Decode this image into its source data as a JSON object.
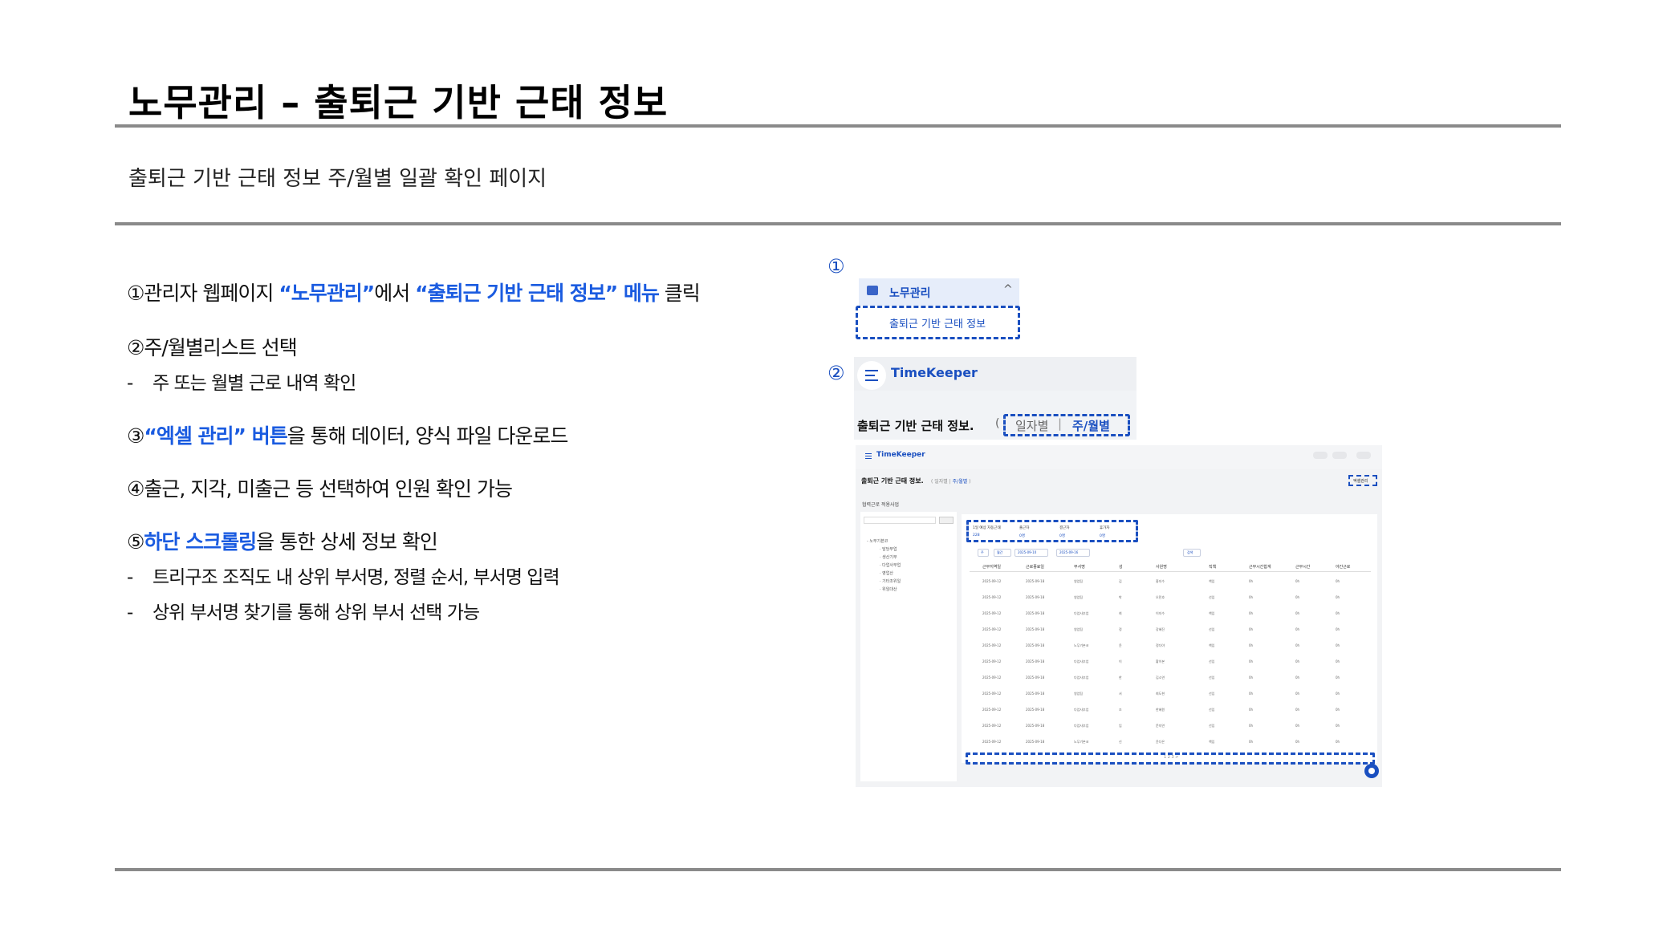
{
  "title": "노무관리 – 출퇴근 기반 근태 정보",
  "subtitle": "출퇴근 기반 근태 정보 주/월별 일괄 확인 페이지",
  "steps": [
    {
      "num": "①",
      "pre": "관리자 웹페이지 ",
      "hl1": "“노무관리”",
      "mid": "에서 ",
      "hl2": "“출퇴근 기반 근태 정보” 메뉴",
      "post": " 클릭"
    },
    {
      "num": "②",
      "text": "주/월별리스트 선택",
      "sub": "주 또는 월별 근로 내역 확인"
    },
    {
      "num": "③",
      "hl": "“엑셀 관리” 버튼",
      "post": "을 통해 데이터, 양식 파일 다운로드"
    },
    {
      "num": "④",
      "text": "출근, 지각, 미출근 등 선택하여 인원 확인 가능"
    },
    {
      "num": "⑤",
      "hl": "하단 스크롤링",
      "post": "을 통한 상세 정보 확인",
      "subs": [
        "트리구조 조직도 내 상위 부서명, 정렬 순서, 부서명 입력",
        "상위 부서명 찾기를 통해 상위 부서 선택 가능"
      ]
    }
  ],
  "dash": "-",
  "markers": [
    "①",
    "②",
    "③",
    "④",
    "⑤"
  ],
  "menu": {
    "section": "노무관리",
    "caret": "^",
    "item": "출퇴근 기반 근태 정보"
  },
  "header": {
    "brand": "TimeKeeper",
    "page_title": "출퇴근 기반 근태 정보.",
    "paren_open": "(",
    "tab_daily": "일자별",
    "tab_sep": "|",
    "tab_weekly": "주/월별"
  },
  "app": {
    "brand": "TimeKeeper",
    "title": "출퇴근 기반 근태 정보.",
    "tabs_pre": "( 일자별 | ",
    "tab_active": "주/월별",
    "tabs_post": " )",
    "excel": "엑셀관리",
    "side_label": "협력근로 적용사업",
    "side_btn": "검색",
    "tree": [
      "- 노무기본코",
      "· 담당부업",
      "· 생산기부",
      "· 다업사부업",
      "· 영업산",
      "· 기타조위일",
      "· 위임대산"
    ],
    "stats": [
      {
        "label": "1일 예상 자동근태",
        "value": "228"
      },
      {
        "label": "출근자",
        "value": "0명"
      },
      {
        "label": "결근자",
        "value": "0명"
      },
      {
        "label": "휴가자",
        "value": "0명"
      }
    ],
    "filters": [
      "주",
      "월간",
      "2025-09-10",
      "2025-09-16",
      "검색"
    ],
    "columns": [
      "근무지역일",
      "근로종료일",
      "부서명",
      "성",
      "사원명",
      "직책",
      "근무시간합계",
      "근무시간",
      "야간근로"
    ],
    "rows": [
      [
        "2025-09-12",
        "2025-09-18",
        "영업팀",
        "김",
        "홍지수",
        "책임",
        "0h",
        "0h",
        "0h"
      ],
      [
        "2025-09-12",
        "2025-09-18",
        "영업팀",
        "박",
        "오민호",
        "선임",
        "0h",
        "0h",
        "0h"
      ],
      [
        "2025-09-12",
        "2025-09-18",
        "다업사부업",
        "최",
        "이지수",
        "책임",
        "0h",
        "0h",
        "0h"
      ],
      [
        "2025-09-12",
        "2025-09-18",
        "영업팀",
        "정",
        "강혜진",
        "선임",
        "0h",
        "0h",
        "0h"
      ],
      [
        "2025-09-12",
        "2025-09-18",
        "노무기본코",
        "윤",
        "정다야",
        "책임",
        "0h",
        "0h",
        "0h"
      ],
      [
        "2025-09-12",
        "2025-09-18",
        "다업사부업",
        "이",
        "황이본",
        "선임",
        "0h",
        "0h",
        "0h"
      ],
      [
        "2025-09-12",
        "2025-09-18",
        "다업사부업",
        "한",
        "김소연",
        "선임",
        "0h",
        "0h",
        "0h"
      ],
      [
        "2025-09-12",
        "2025-09-18",
        "영업팀",
        "서",
        "최도현",
        "선임",
        "0h",
        "0h",
        "0h"
      ],
      [
        "2025-09-12",
        "2025-09-18",
        "다업사부업",
        "조",
        "한혜원",
        "선임",
        "0h",
        "0h",
        "0h"
      ],
      [
        "2025-09-12",
        "2025-09-18",
        "다업사부업",
        "임",
        "문지연",
        "선임",
        "0h",
        "0h",
        "0h"
      ],
      [
        "2025-09-12",
        "2025-09-18",
        "노무기본코",
        "신",
        "윤다은",
        "책임",
        "0h",
        "0h",
        "0h"
      ]
    ],
    "pager": "1 2 3 >"
  },
  "colors": {
    "accent": "#1a4fc0",
    "highlight": "#1a5be0",
    "rule": "#8a8a8a"
  }
}
